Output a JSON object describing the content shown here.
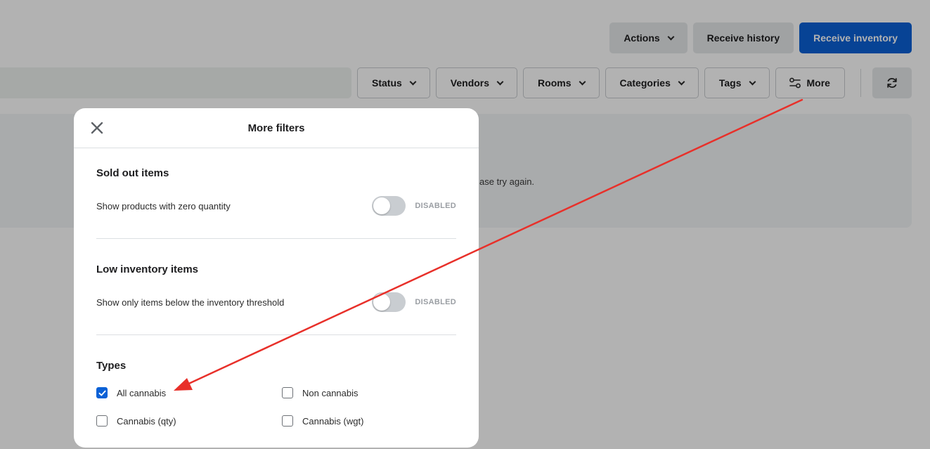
{
  "header": {
    "actions_label": "Actions",
    "receive_history_label": "Receive history",
    "receive_inventory_label": "Receive inventory"
  },
  "filters": {
    "status": "Status",
    "vendors": "Vendors",
    "rooms": "Rooms",
    "categories": "Categories",
    "tags": "Tags",
    "more": "More"
  },
  "background": {
    "message_fragment": "ase try again."
  },
  "modal": {
    "title": "More filters",
    "sold_out": {
      "title": "Sold out items",
      "label": "Show products with zero quantity",
      "status": "DISABLED"
    },
    "low_inventory": {
      "title": "Low inventory items",
      "label": "Show only items below the inventory threshold",
      "status": "DISABLED"
    },
    "types": {
      "title": "Types",
      "all_cannabis": "All cannabis",
      "non_cannabis": "Non cannabis",
      "cannabis_qty": "Cannabis (qty)",
      "cannabis_wgt": "Cannabis (wgt)"
    }
  },
  "colors": {
    "primary": "#0b61d6",
    "annotation_arrow": "#e8302a"
  }
}
